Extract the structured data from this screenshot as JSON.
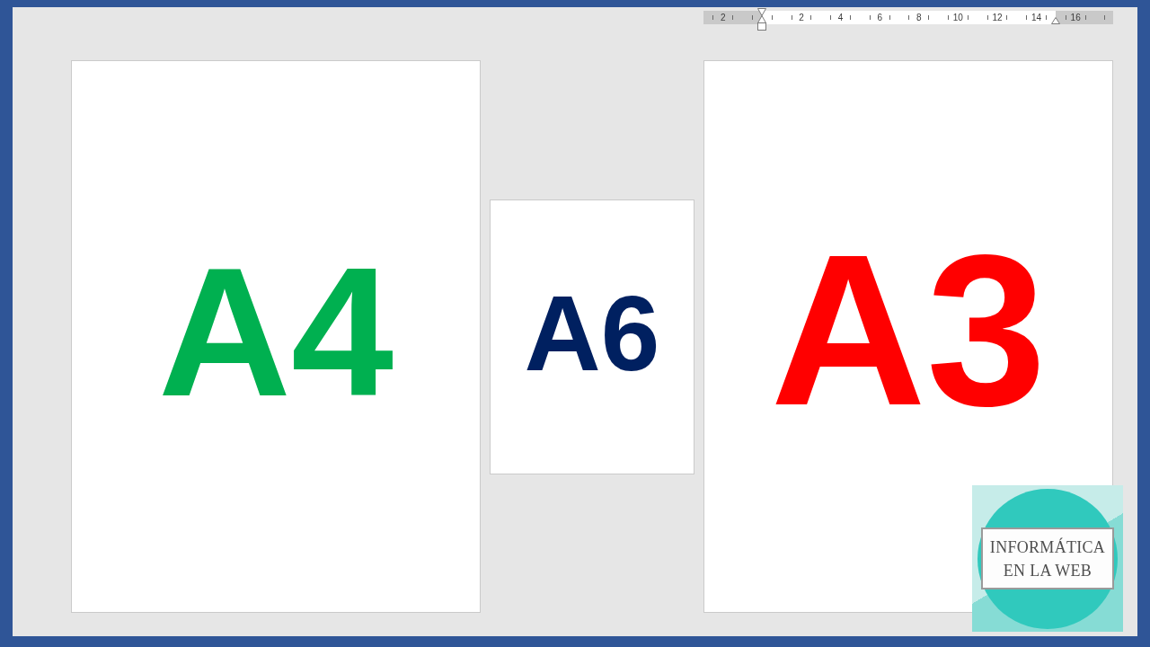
{
  "ruler": {
    "left_margin_numbers": [
      "2"
    ],
    "numbers": [
      "2",
      "4",
      "6",
      "8",
      "10",
      "12",
      "14"
    ],
    "right_margin_numbers": [
      "16"
    ]
  },
  "pages": [
    {
      "label": "A4",
      "color": "#00b050",
      "kind": "medium"
    },
    {
      "label": "A6",
      "color": "#002060",
      "kind": "small"
    },
    {
      "label": "A3",
      "color": "#ff0000",
      "kind": "large"
    }
  ],
  "logo": {
    "lines": [
      "INFORMÁTICA",
      "EN LA WEB"
    ]
  }
}
